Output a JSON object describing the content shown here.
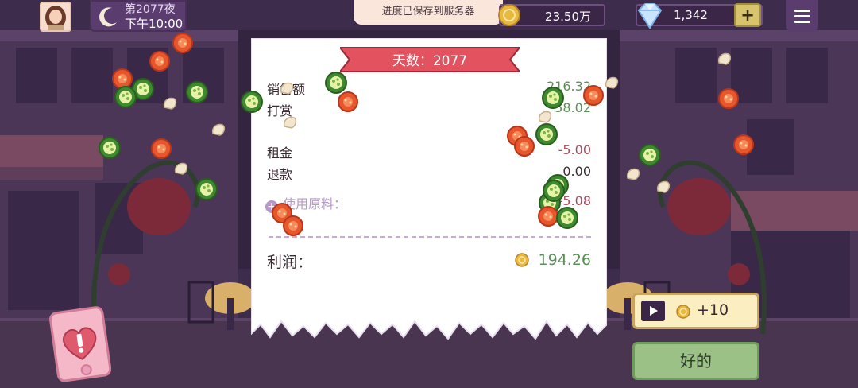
{
  "hud": {
    "day_label": "第2077夜",
    "time_label": "下午10:00",
    "toast": "进度已保存到服务器",
    "coins": "23.50万",
    "gems": "1,342",
    "plus_label": "+",
    "icons": {
      "avatar": "avatar-icon",
      "moon": "moon-icon",
      "coin": "coin-icon",
      "gem": "diamond-icon",
      "menu": "hamburger-menu-icon"
    }
  },
  "receipt": {
    "title": "天数：2077",
    "rows": [
      {
        "label": "销售额",
        "value": "216.32"
      },
      {
        "label": "打赏",
        "value": "58.02"
      },
      {
        "label": "租金",
        "value": "-5.00"
      },
      {
        "label": "退款",
        "value": "0.00"
      },
      {
        "label": "使用原料：",
        "value": "-5.08"
      }
    ],
    "profit_label": "利润：",
    "profit_value": "194.26"
  },
  "buttons": {
    "ad_reward": "+10",
    "ok": "好的"
  },
  "colors": {
    "background": "#3b2a48",
    "banner": "#e2525f",
    "positive": "#5b8f58",
    "negative": "#b3485b",
    "ok_button": "#9cc186",
    "ad_button": "#fbeec0"
  }
}
